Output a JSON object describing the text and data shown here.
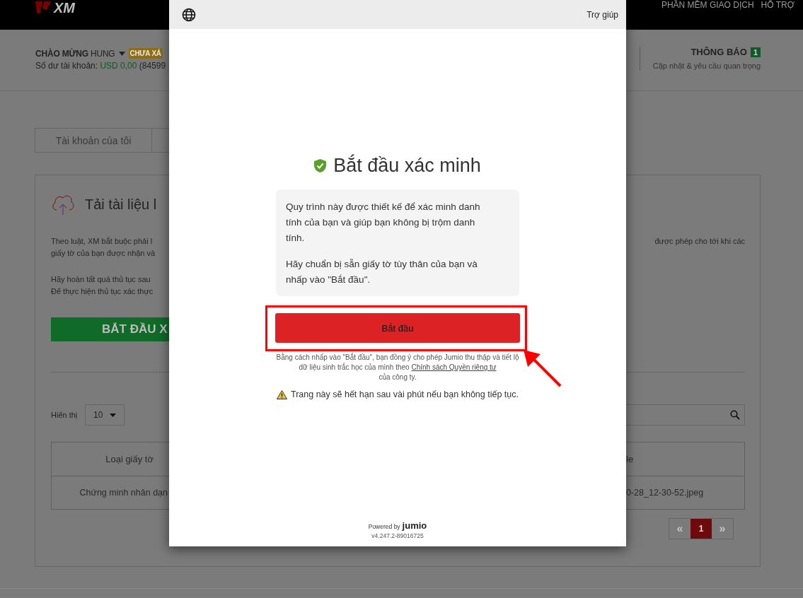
{
  "header": {
    "logo": "XM",
    "nav": [
      "PHẦN MỀM GIAO DỊCH",
      "HỖ TRỢ"
    ]
  },
  "account": {
    "greeting": "CHÀO MỪNG",
    "user": "HUNG",
    "status_badge": "CHƯA XÁ",
    "balance_label": "Số dư tài khoản:",
    "balance": "USD 0,00",
    "account_number": "(84599"
  },
  "notifications": {
    "title": "THÔNG BÁO",
    "count": "1",
    "subtitle": "Cập nhật & yêu cầu quan trọng"
  },
  "tabs": [
    {
      "label": "Tài khoản của tôi"
    }
  ],
  "upload_card": {
    "title": "Tải tài liệu l",
    "intro_left": [
      "Theo luật, XM bắt buộc phải l",
      "giấy tờ của bạn được nhận và"
    ],
    "intro_right": "được phép cho tới khi các",
    "steps": [
      "Hãy hoàn tất quá thủ tục sau",
      "Để thực hiện thủ tục xác thực"
    ],
    "start_button": "BẮT ĐẦU X",
    "show_label": "Hiển thị",
    "page_size": "10",
    "table": {
      "columns": [
        "Loại giấy tờ",
        "le"
      ],
      "rows": [
        [
          "Chứng minh nhân dạn",
          "0-28_12-30-52.jpeg"
        ]
      ]
    },
    "pagination": [
      {
        "label": "«",
        "selected": false
      },
      {
        "label": "1",
        "selected": true
      },
      {
        "label": "»",
        "selected": false
      }
    ]
  },
  "modal": {
    "help": "Trợ giúp",
    "title": "Bắt đầu xác minh",
    "info": [
      "Quy trình này được thiết kế để xác minh danh tính của bạn và giúp bạn không bị trộm danh tính.",
      "Hãy chuẩn bị sẵn giấy tờ tùy thân của bạn và nhấp vào \"Bắt đầu\"."
    ],
    "start_button": "Bắt đầu",
    "consent": "Bằng cách nhấp vào \"Bắt đầu\", bạn đồng ý cho phép Jumio thu thập và tiết lộ dữ liệu sinh trắc học của mình theo",
    "privacy_link": "Chính sách Quyền riêng tư",
    "consent_end": "của công ty.",
    "warning": "Trang này sẽ hết hạn sau vài phút nếu bạn không tiếp tục.",
    "powered_by": "Powered by",
    "brand": "jumio",
    "version": "v4.247.2-89016725"
  }
}
